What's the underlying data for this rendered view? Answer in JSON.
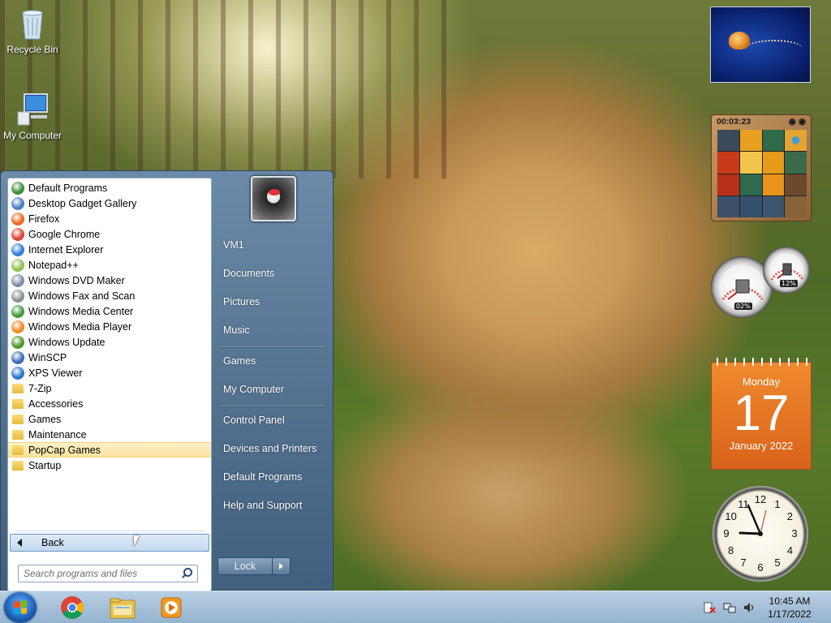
{
  "desktop": {
    "icons": [
      {
        "label": "Recycle Bin",
        "icon": "recycle-bin-icon"
      },
      {
        "label": "My Computer",
        "icon": "computer-icon"
      }
    ]
  },
  "start_menu": {
    "programs": [
      {
        "label": "Default Programs",
        "icon": "default-programs-icon",
        "color": "#3d8f3a"
      },
      {
        "label": "Desktop Gadget Gallery",
        "icon": "gadget-gallery-icon",
        "color": "#4b7fc1"
      },
      {
        "label": "Firefox",
        "icon": "firefox-icon",
        "color": "#e66a1f"
      },
      {
        "label": "Google Chrome",
        "icon": "chrome-icon",
        "color": "#db4437"
      },
      {
        "label": "Internet Explorer",
        "icon": "ie-icon",
        "color": "#2f7ed8"
      },
      {
        "label": "Notepad++",
        "icon": "notepadpp-icon",
        "color": "#8bc34a"
      },
      {
        "label": "Windows DVD Maker",
        "icon": "dvd-maker-icon",
        "color": "#7b8fa6"
      },
      {
        "label": "Windows Fax and Scan",
        "icon": "fax-scan-icon",
        "color": "#8a8f96"
      },
      {
        "label": "Windows Media Center",
        "icon": "media-center-icon",
        "color": "#3f9b3c"
      },
      {
        "label": "Windows Media Player",
        "icon": "media-player-icon",
        "color": "#f08a24"
      },
      {
        "label": "Windows Update",
        "icon": "windows-update-icon",
        "color": "#4e9a2e"
      },
      {
        "label": "WinSCP",
        "icon": "winscp-icon",
        "color": "#3a6fb5"
      },
      {
        "label": "XPS Viewer",
        "icon": "xps-viewer-icon",
        "color": "#2a77c9"
      },
      {
        "label": "7-Zip",
        "icon": "folder-icon",
        "color": "#e8b93a"
      },
      {
        "label": "Accessories",
        "icon": "folder-icon",
        "color": "#e8b93a"
      },
      {
        "label": "Games",
        "icon": "folder-icon",
        "color": "#e8b93a"
      },
      {
        "label": "Maintenance",
        "icon": "folder-icon",
        "color": "#e8b93a"
      },
      {
        "label": "PopCap Games",
        "icon": "folder-icon",
        "color": "#e8b93a"
      },
      {
        "label": "Startup",
        "icon": "folder-icon",
        "color": "#e8b93a"
      }
    ],
    "highlighted": "PopCap Games",
    "back_label": "Back",
    "search_placeholder": "Search programs and files",
    "right_items": [
      {
        "label": "VM1"
      },
      {
        "label": "Documents"
      },
      {
        "label": "Pictures"
      },
      {
        "label": "Music"
      },
      {
        "label": "Games"
      },
      {
        "label": "My Computer"
      },
      {
        "label": "Control Panel"
      },
      {
        "label": "Devices and Printers"
      },
      {
        "label": "Default Programs"
      },
      {
        "label": "Help and Support"
      }
    ],
    "lock_label": "Lock"
  },
  "gadgets": {
    "puzzle_timer": "00:03:23",
    "cpu_percent": "02%",
    "memory_percent": "12%",
    "calendar": {
      "day": "Monday",
      "date": "17",
      "month_year": "January 2022"
    },
    "clock_numbers": [
      "12",
      "1",
      "2",
      "3",
      "4",
      "5",
      "6",
      "7",
      "8",
      "9",
      "10",
      "11"
    ]
  },
  "taskbar": {
    "time": "10:45 AM",
    "date": "1/17/2022",
    "pinned": [
      {
        "name": "chrome-icon"
      },
      {
        "name": "explorer-icon"
      },
      {
        "name": "media-player-icon"
      }
    ]
  }
}
